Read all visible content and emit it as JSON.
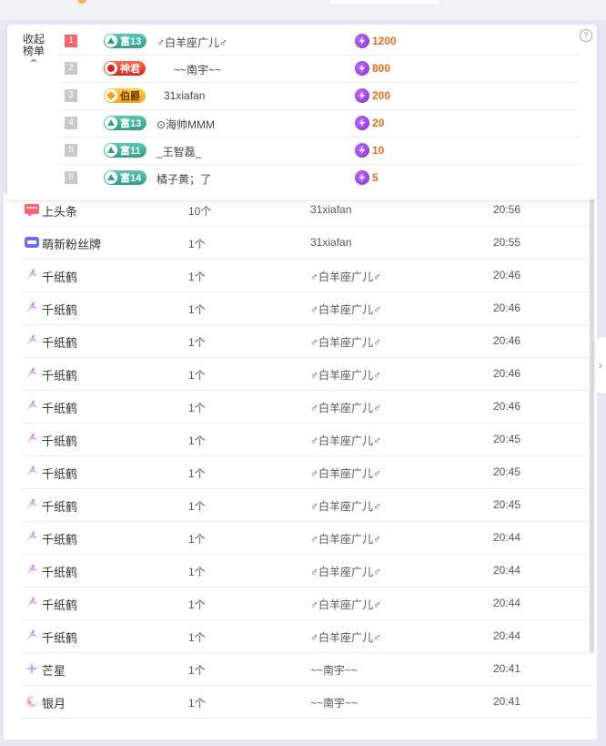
{
  "rank_panel": {
    "collapse_label": "收起榜单",
    "collapse_chevron": "chevron-up-icon",
    "help_icon": "question-icon",
    "rows": [
      {
        "rank": "1",
        "badge_text": "富13",
        "badge_style": "teal",
        "name": "♂白羊座广儿♂",
        "score": "1200"
      },
      {
        "rank": "2",
        "badge_text": "神君",
        "badge_style": "red",
        "name": "~~南宇~~",
        "score": "800"
      },
      {
        "rank": "3",
        "badge_text": "伯爵",
        "badge_style": "gold",
        "name": "31xiafan",
        "score": "200"
      },
      {
        "rank": "4",
        "badge_text": "富13",
        "badge_style": "teal",
        "name": "⊙海帅MMM",
        "score": "20"
      },
      {
        "rank": "5",
        "badge_text": "富11",
        "badge_style": "teal",
        "name": "_王智磊_",
        "score": "10"
      },
      {
        "rank": "6",
        "badge_text": "富14",
        "badge_style": "teal",
        "name": "橘子黄；了",
        "score": "5"
      }
    ]
  },
  "gift_log": {
    "rows": [
      {
        "icon": "headline-icon",
        "gift": "上头条",
        "count": "10个",
        "user": "31xiafan",
        "time": "20:56"
      },
      {
        "icon": "fan-badge-icon",
        "gift": "萌新粉丝牌",
        "count": "1个",
        "user": "31xiafan",
        "time": "20:55"
      },
      {
        "icon": "paper-crane-icon",
        "gift": "千纸鹤",
        "count": "1个",
        "user": "♂白羊座广儿♂",
        "time": "20:46"
      },
      {
        "icon": "paper-crane-icon",
        "gift": "千纸鹤",
        "count": "1个",
        "user": "♂白羊座广儿♂",
        "time": "20:46"
      },
      {
        "icon": "paper-crane-icon",
        "gift": "千纸鹤",
        "count": "1个",
        "user": "♂白羊座广儿♂",
        "time": "20:46"
      },
      {
        "icon": "paper-crane-icon",
        "gift": "千纸鹤",
        "count": "1个",
        "user": "♂白羊座广儿♂",
        "time": "20:46"
      },
      {
        "icon": "paper-crane-icon",
        "gift": "千纸鹤",
        "count": "1个",
        "user": "♂白羊座广儿♂",
        "time": "20:46"
      },
      {
        "icon": "paper-crane-icon",
        "gift": "千纸鹤",
        "count": "1个",
        "user": "♂白羊座广儿♂",
        "time": "20:45"
      },
      {
        "icon": "paper-crane-icon",
        "gift": "千纸鹤",
        "count": "1个",
        "user": "♂白羊座广儿♂",
        "time": "20:45"
      },
      {
        "icon": "paper-crane-icon",
        "gift": "千纸鹤",
        "count": "1个",
        "user": "♂白羊座广儿♂",
        "time": "20:45"
      },
      {
        "icon": "paper-crane-icon",
        "gift": "千纸鹤",
        "count": "1个",
        "user": "♂白羊座广儿♂",
        "time": "20:44"
      },
      {
        "icon": "paper-crane-icon",
        "gift": "千纸鹤",
        "count": "1个",
        "user": "♂白羊座广儿♂",
        "time": "20:44"
      },
      {
        "icon": "paper-crane-icon",
        "gift": "千纸鹤",
        "count": "1个",
        "user": "♂白羊座广儿♂",
        "time": "20:44"
      },
      {
        "icon": "paper-crane-icon",
        "gift": "千纸鹤",
        "count": "1个",
        "user": "♂白羊座广儿♂",
        "time": "20:44"
      },
      {
        "icon": "star-icon",
        "gift": "芒星",
        "count": "1个",
        "user": "~~南宇~~",
        "time": "20:41"
      },
      {
        "icon": "moon-icon",
        "gift": "银月",
        "count": "1个",
        "user": "~~南宇~~",
        "time": "20:41"
      }
    ]
  },
  "side_tab_icon": "chevron-right-icon",
  "colors": {
    "rank_first": "#f06671",
    "score_text": "#e76a1a",
    "badge_teal": "#2f9e8a",
    "badge_red": "#d9231e",
    "badge_gold": "#f0a31b"
  }
}
